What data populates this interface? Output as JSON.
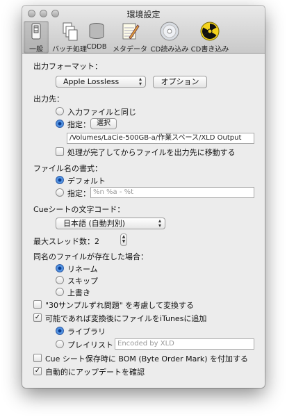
{
  "window": {
    "title": "環境設定"
  },
  "toolbar": [
    {
      "label": "一般"
    },
    {
      "label": "バッチ処理"
    },
    {
      "label": "CDDB"
    },
    {
      "label": "メタデータ"
    },
    {
      "label": "CD読み込み"
    },
    {
      "label": "CD書き込み"
    }
  ],
  "output_format": {
    "label": "出力フォーマット：",
    "value": "Apple Lossless",
    "options_button": "オプション"
  },
  "destination": {
    "label": "出力先：",
    "same_as_input": "入力ファイルと同じ",
    "specify": "指定：",
    "choose_button": "選択",
    "path": "/Volumes/LaCie-500GB-a/作業スペース/XLD Output",
    "move_after": "処理が完了してからファイルを出力先に移動する"
  },
  "filename_format": {
    "label": "ファイル名の書式：",
    "default": "デフォルト",
    "specify": "指定：",
    "pattern_placeholder": "%n %a - %t"
  },
  "cue_encoding": {
    "label": "Cueシートの文字コード：",
    "value": "日本語 (自動判別)"
  },
  "max_threads": {
    "label": "最大スレッド数：2"
  },
  "existing_file": {
    "label": "同名のファイルが存在した場合：",
    "rename": "リネーム",
    "skip": "スキップ",
    "overwrite": "上書き"
  },
  "offset_fix": {
    "label": "\"30サンプルずれ問題\" を考慮して変換する"
  },
  "itunes": {
    "label": "可能であれば変換後にファイルをiTunesに追加",
    "library": "ライブラリ",
    "playlist": "プレイリスト",
    "playlist_placeholder": "Encoded by XLD"
  },
  "cue_bom": {
    "label": "Cue シート保存時に BOM (Byte Order Mark) を付加する"
  },
  "auto_update": {
    "label": "自動的にアップデートを確認"
  }
}
